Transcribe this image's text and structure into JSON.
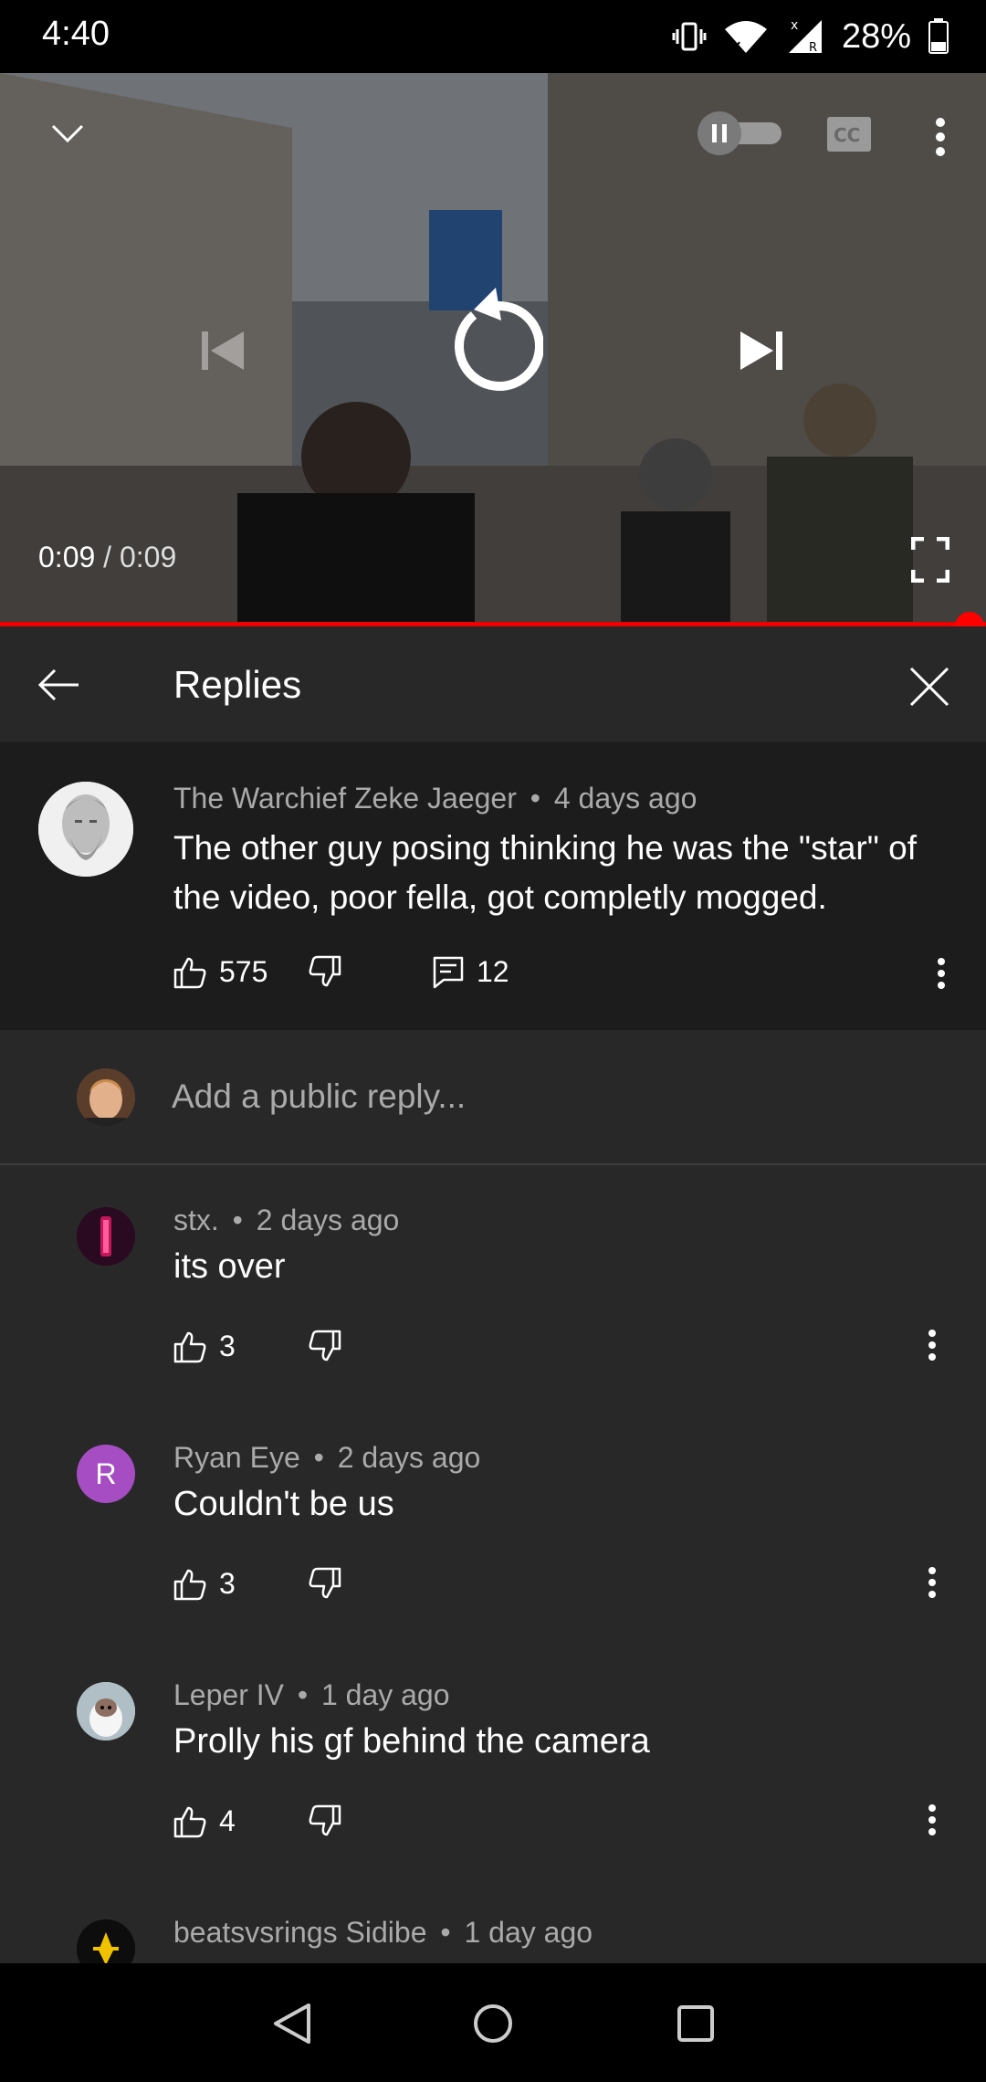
{
  "status_bar": {
    "time": "4:40",
    "battery_percent": "28%",
    "icons": [
      "vibrate-icon",
      "wifi-icon",
      "signal-icon",
      "battery-icon"
    ]
  },
  "player": {
    "current_time": "0:09",
    "separator": "/",
    "duration": "0:09",
    "progress_fraction": 1.0,
    "autoplay_on": false,
    "icons": [
      "chevron-down-icon",
      "autoplay-toggle",
      "cc-icon",
      "more-vert-icon",
      "previous-icon",
      "replay-icon",
      "next-icon",
      "fullscreen-icon"
    ]
  },
  "replies_header": {
    "title": "Replies",
    "icons": [
      "back-arrow-icon",
      "close-icon"
    ]
  },
  "parent_comment": {
    "author": "The Warchief Zeke Jaeger",
    "age": "4 days ago",
    "text_line1": "The other guy posing thinking he was the \"star\" of",
    "text_line2": "the video, poor fella, got completly mogged.",
    "likes": "575",
    "replies_count": "12"
  },
  "add_reply": {
    "placeholder": "Add a public reply..."
  },
  "replies": [
    {
      "author": "stx.",
      "age": "2 days ago",
      "text": "its over",
      "likes": "3"
    },
    {
      "author": "Ryan Eye",
      "age": "2 days ago",
      "text": "Couldn't be us",
      "likes": "3",
      "avatar_letter": "R",
      "avatar_color": "#a64dc4"
    },
    {
      "author": "Leper IV",
      "age": "1 day ago",
      "text": "Prolly his gf behind the camera",
      "likes": "4"
    },
    {
      "author": "beatsvsrings Sidibe",
      "age": "1 day ago"
    }
  ],
  "meta_separator": "•",
  "nav_bar": {
    "icons": [
      "nav-back-icon",
      "nav-home-icon",
      "nav-recents-icon"
    ]
  },
  "colors": {
    "accent_red": "#ff0000",
    "background": "#282828",
    "parent_background": "#1c1c1c"
  }
}
